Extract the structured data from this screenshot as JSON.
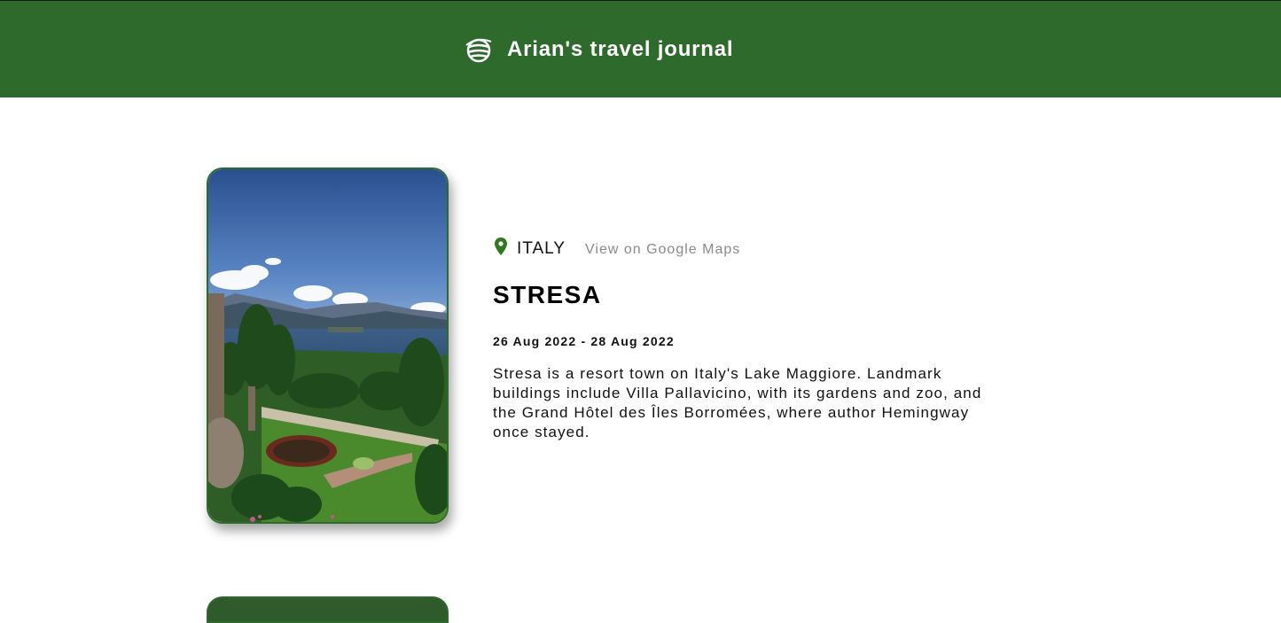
{
  "header": {
    "title": "Arian's travel journal",
    "logo_icon": "globe-icon",
    "background": "#2d6a2b"
  },
  "entry": {
    "location_icon": "map-pin-icon",
    "country": "ITALY",
    "maps_link_label": "View on Google Maps",
    "title": "STRESA",
    "dates": "26 Aug 2022 - 28 Aug 2022",
    "description": "Stresa is a resort town on Italy's Lake Maggiore. Landmark buildings include Villa Pallavicino, with its gardens and zoo, and the Grand Hôtel des Îles Borromées, where author Hemingway once stayed.",
    "accent_color": "#2d6a2b"
  }
}
